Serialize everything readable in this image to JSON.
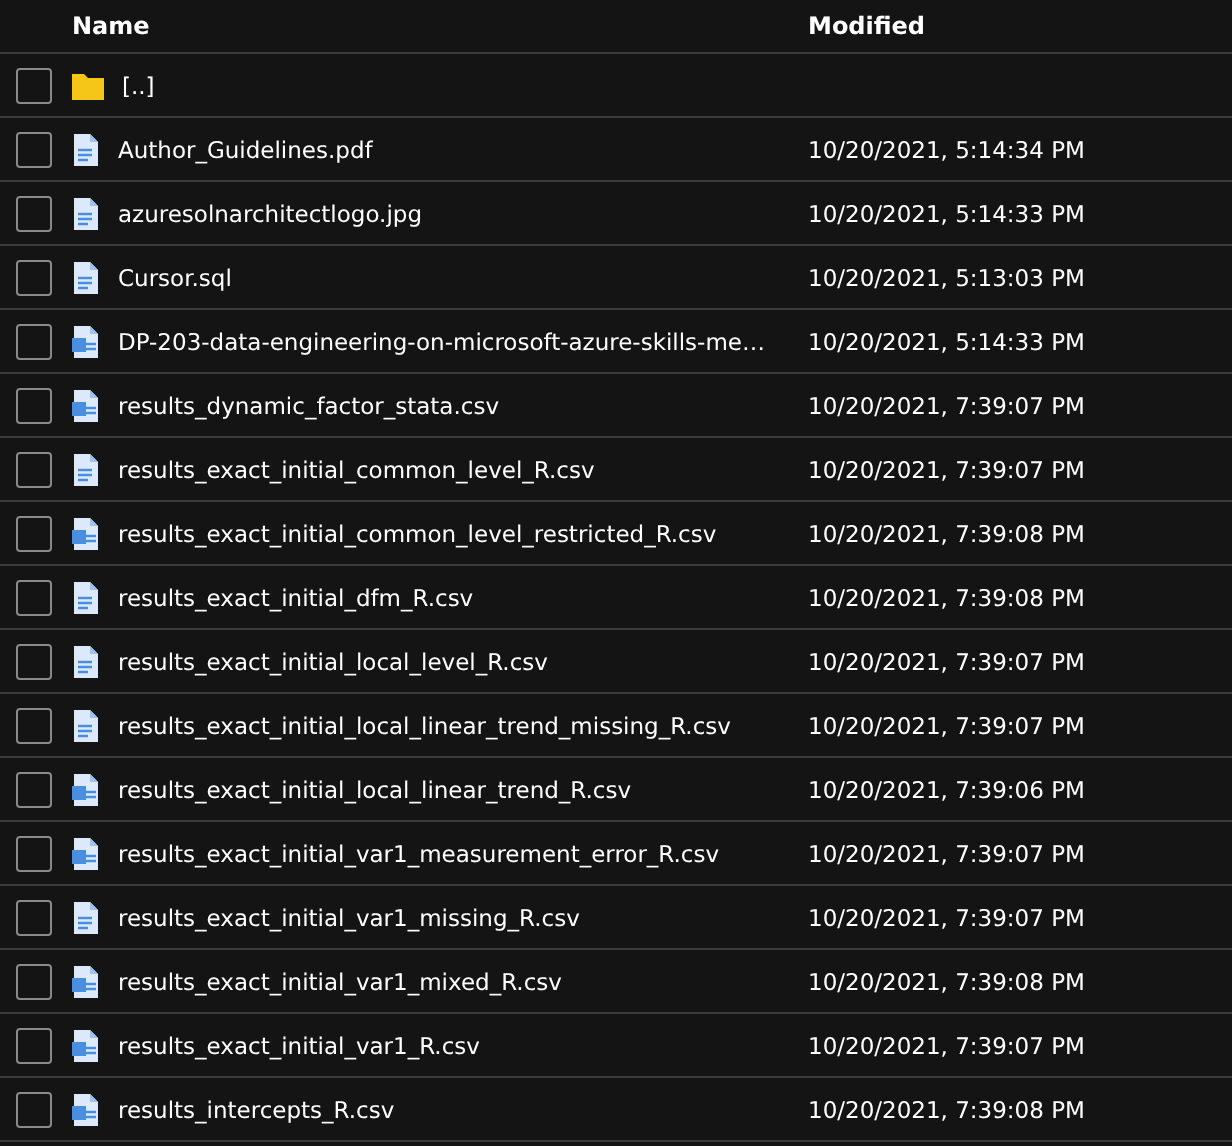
{
  "table": {
    "columns": [
      "Name",
      "Modified"
    ],
    "rows": [
      {
        "kind": "folder",
        "name": "[..]",
        "modified": "",
        "checked": false
      },
      {
        "kind": "document",
        "name": "Author_Guidelines.pdf",
        "modified": "10/20/2021, 5:14:34 PM",
        "checked": false
      },
      {
        "kind": "document",
        "name": "azuresolnarchitectlogo.jpg",
        "modified": "10/20/2021, 5:14:33 PM",
        "checked": false
      },
      {
        "kind": "document",
        "name": "Cursor.sql",
        "modified": "10/20/2021, 5:13:03 PM",
        "checked": false
      },
      {
        "kind": "spreadsheet",
        "name": "DP-203-data-engineering-on-microsoft-azure-skills-me…",
        "modified": "10/20/2021, 5:14:33 PM",
        "checked": false
      },
      {
        "kind": "spreadsheet",
        "name": "results_dynamic_factor_stata.csv",
        "modified": "10/20/2021, 7:39:07 PM",
        "checked": false
      },
      {
        "kind": "document",
        "name": "results_exact_initial_common_level_R.csv",
        "modified": "10/20/2021, 7:39:07 PM",
        "checked": false
      },
      {
        "kind": "spreadsheet",
        "name": "results_exact_initial_common_level_restricted_R.csv",
        "modified": "10/20/2021, 7:39:08 PM",
        "checked": false
      },
      {
        "kind": "document",
        "name": "results_exact_initial_dfm_R.csv",
        "modified": "10/20/2021, 7:39:08 PM",
        "checked": false
      },
      {
        "kind": "document",
        "name": "results_exact_initial_local_level_R.csv",
        "modified": "10/20/2021, 7:39:07 PM",
        "checked": false
      },
      {
        "kind": "document",
        "name": "results_exact_initial_local_linear_trend_missing_R.csv",
        "modified": "10/20/2021, 7:39:07 PM",
        "checked": false
      },
      {
        "kind": "spreadsheet",
        "name": "results_exact_initial_local_linear_trend_R.csv",
        "modified": "10/20/2021, 7:39:06 PM",
        "checked": false
      },
      {
        "kind": "spreadsheet",
        "name": "results_exact_initial_var1_measurement_error_R.csv",
        "modified": "10/20/2021, 7:39:07 PM",
        "checked": false
      },
      {
        "kind": "document",
        "name": "results_exact_initial_var1_missing_R.csv",
        "modified": "10/20/2021, 7:39:07 PM",
        "checked": false
      },
      {
        "kind": "spreadsheet",
        "name": "results_exact_initial_var1_mixed_R.csv",
        "modified": "10/20/2021, 7:39:08 PM",
        "checked": false
      },
      {
        "kind": "spreadsheet",
        "name": "results_exact_initial_var1_R.csv",
        "modified": "10/20/2021, 7:39:07 PM",
        "checked": false
      },
      {
        "kind": "spreadsheet",
        "name": "results_intercepts_R.csv",
        "modified": "10/20/2021, 7:39:08 PM",
        "checked": false
      }
    ]
  }
}
